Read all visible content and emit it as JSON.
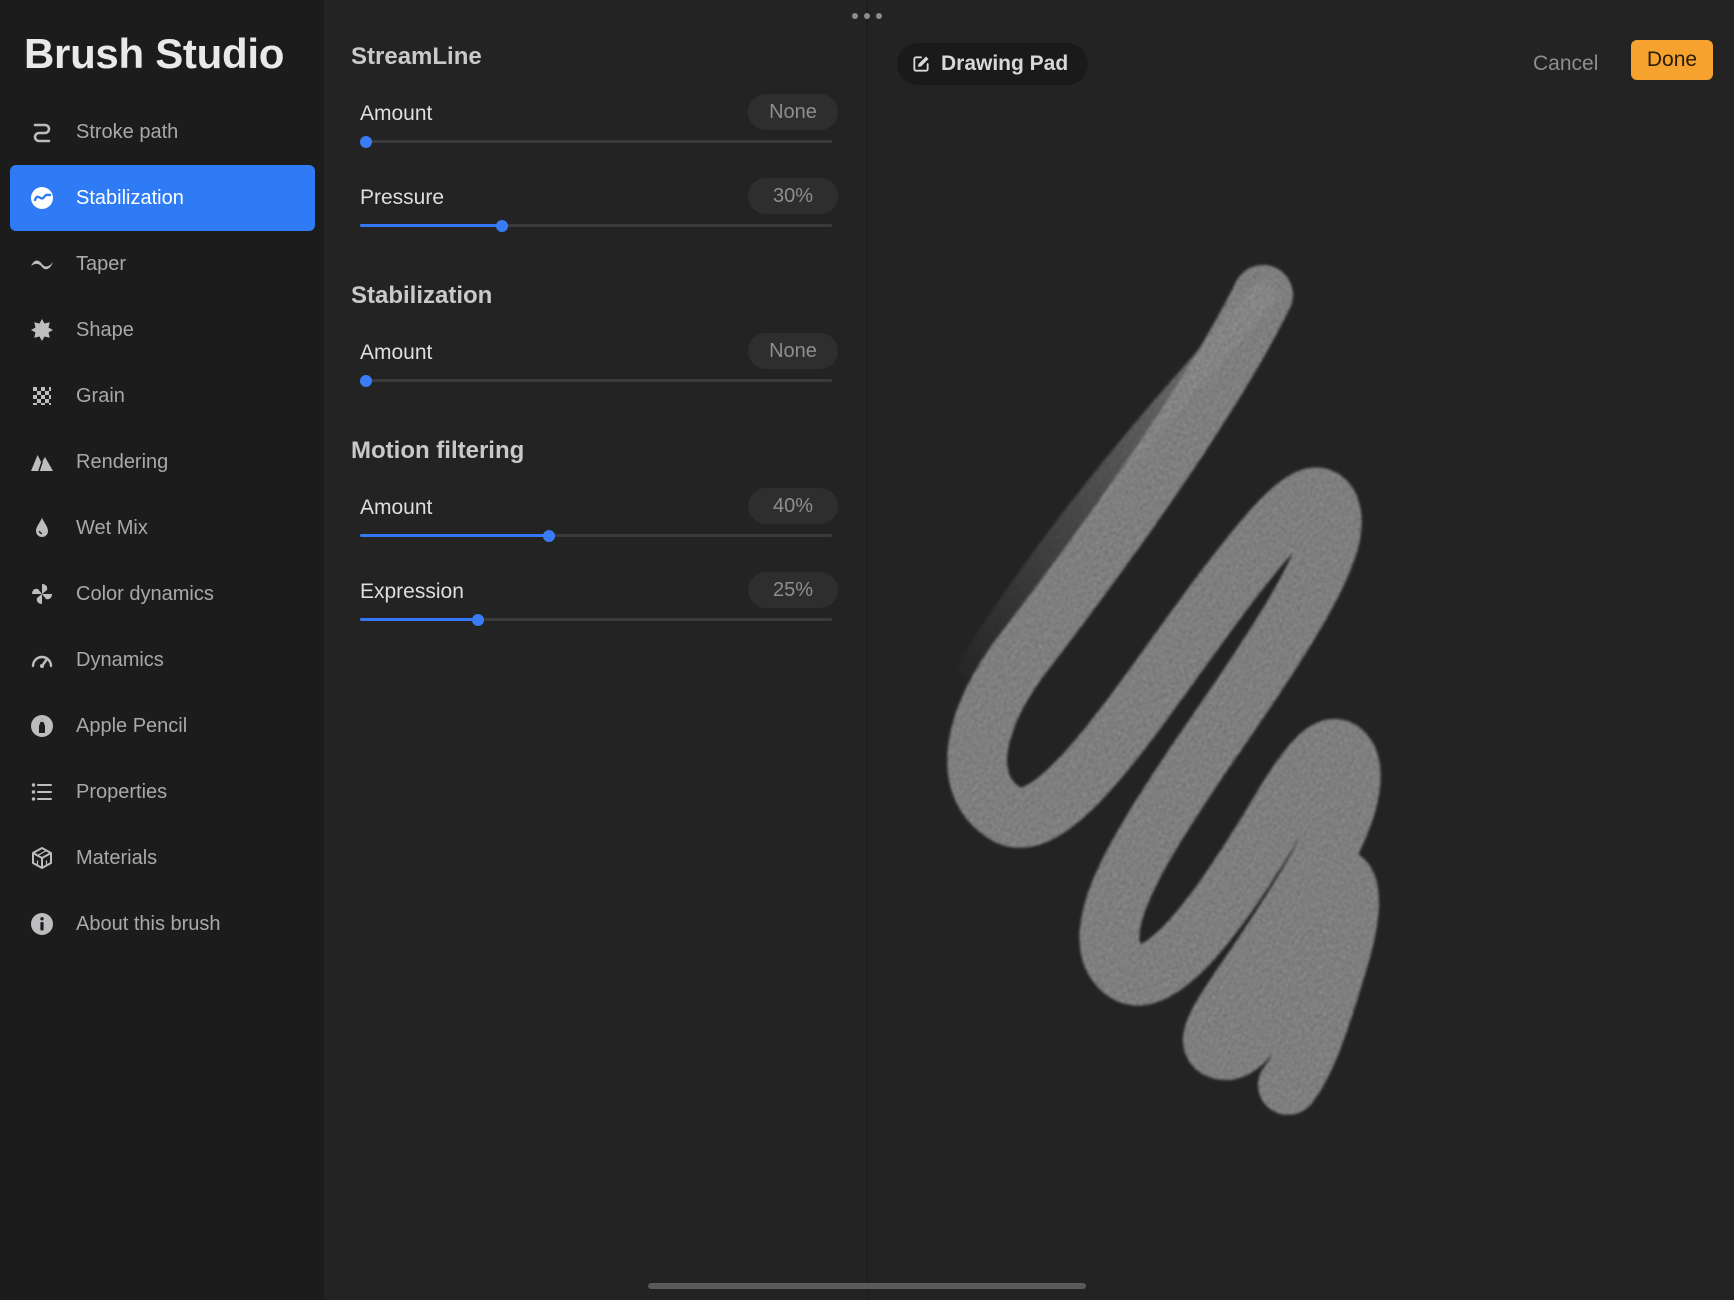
{
  "sidebar": {
    "title": "Brush Studio",
    "active_index": 1,
    "items": [
      {
        "label": "Stroke path",
        "icon": "stroke-path-icon"
      },
      {
        "label": "Stabilization",
        "icon": "stabilization-icon"
      },
      {
        "label": "Taper",
        "icon": "taper-icon"
      },
      {
        "label": "Shape",
        "icon": "shape-icon"
      },
      {
        "label": "Grain",
        "icon": "grain-icon"
      },
      {
        "label": "Rendering",
        "icon": "rendering-icon"
      },
      {
        "label": "Wet Mix",
        "icon": "wet-mix-icon"
      },
      {
        "label": "Color dynamics",
        "icon": "color-dynamics-icon"
      },
      {
        "label": "Dynamics",
        "icon": "dynamics-icon"
      },
      {
        "label": "Apple Pencil",
        "icon": "apple-pencil-icon"
      },
      {
        "label": "Properties",
        "icon": "properties-icon"
      },
      {
        "label": "Materials",
        "icon": "materials-icon"
      },
      {
        "label": "About this brush",
        "icon": "info-icon"
      }
    ]
  },
  "panel": {
    "streamline": {
      "title": "StreamLine",
      "amount": {
        "label": "Amount",
        "value": "None",
        "level": 0.0
      },
      "pressure": {
        "label": "Pressure",
        "value": "30%",
        "level": 0.3
      }
    },
    "stabilization": {
      "title": "Stabilization",
      "amount": {
        "label": "Amount",
        "value": "None",
        "level": 0.0
      }
    },
    "motion_filtering": {
      "title": "Motion filtering",
      "amount": {
        "label": "Amount",
        "value": "40%",
        "level": 0.4
      },
      "expression": {
        "label": "Expression",
        "value": "25%",
        "level": 0.25
      }
    }
  },
  "pad": {
    "label": "Drawing Pad",
    "cancel_label": "Cancel",
    "done_label": "Done"
  },
  "colors": {
    "accent": "#2e7bf5",
    "done": "#f5a22e"
  }
}
